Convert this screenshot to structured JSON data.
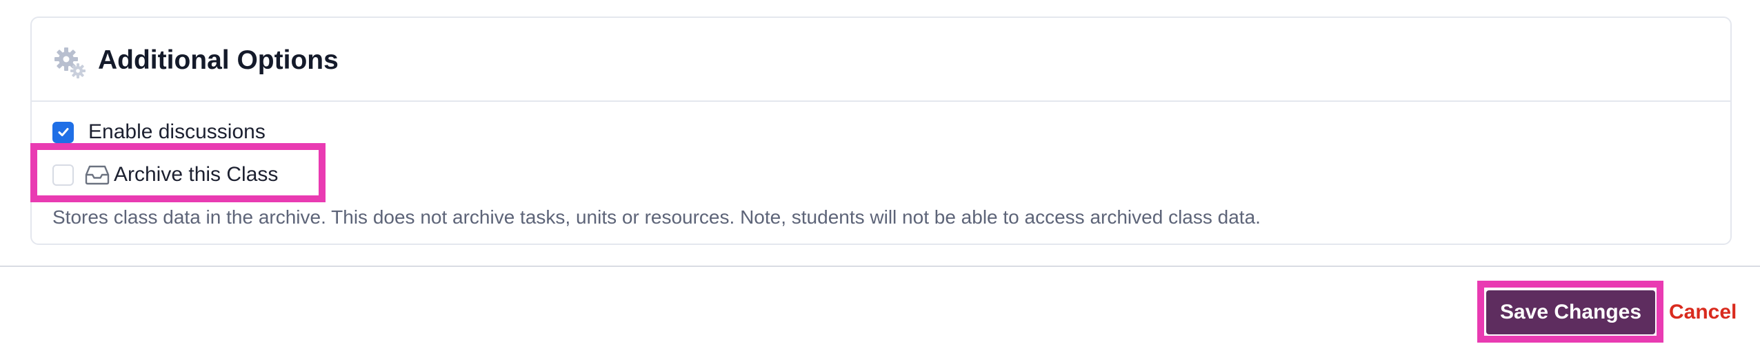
{
  "section": {
    "title": "Additional Options",
    "icon": "gears-icon"
  },
  "options": {
    "enable_discussions": {
      "label": "Enable discussions",
      "checked": true
    },
    "archive_class": {
      "label": "Archive this Class",
      "checked": false,
      "icon": "inbox-icon",
      "help_text": "Stores class data in the archive. This does not archive tasks, units or resources. Note, students will not be able to access archived class data."
    }
  },
  "footer": {
    "save_label": "Save Changes",
    "cancel_label": "Cancel"
  },
  "colors": {
    "primary_button": "#5e2d5f",
    "cancel_text": "#d92b1e",
    "checkbox_checked": "#1f6fe6",
    "highlight": "#e93bb2"
  }
}
